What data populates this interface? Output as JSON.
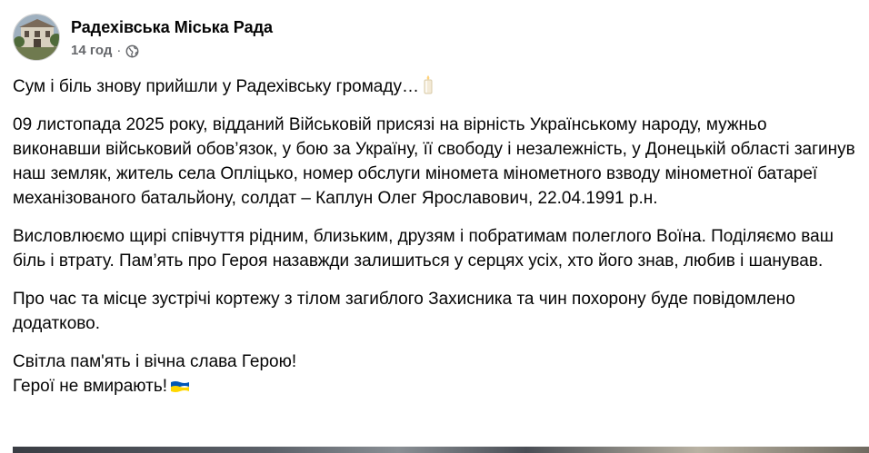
{
  "post": {
    "page_name": "Радехівська Міська Рада",
    "timestamp": "14 год",
    "separator": "·",
    "icons": {
      "avatar": "council-building-avatar",
      "audience": "globe-icon",
      "candle": "candle-emoji",
      "flag": "ukraine-flag-emoji"
    },
    "paragraphs": [
      "Сум і біль знову прийшли у Радехівську громаду…",
      "09 листопада 2025 року, відданий Військовій присязі на вірність Українському народу, мужньо виконавши військовий обов’язок, у бою за Україну, її свободу і незалежність, у Донецькій області загинув наш земляк, житель села Опліцько, номер обслуги міномета мінометного взводу мінометної батареї механізованого батальйону, солдат – Каплун Олег Ярославович, 22.04.1991 р.н.",
      "Висловлюємо щирі співчуття рідним, близьким, друзям і побратимам полеглого Воїна. Поділяємо ваш біль і втрату. Пам’ять про Героя назавжди залишиться у серцях усіх, хто його знав, любив і шанував.",
      "Про час та місце зустрічі кортежу з тілом загиблого Захисника та чин похорону буде повідомлено додатково."
    ],
    "closing_line_1": "Світла пам'ять і вічна слава Герою!",
    "closing_line_2": "Герої не вмирають!"
  },
  "colors": {
    "text_primary": "#050505",
    "text_secondary": "#65676b",
    "flag_blue": "#0057b7",
    "flag_yellow": "#ffd700"
  }
}
